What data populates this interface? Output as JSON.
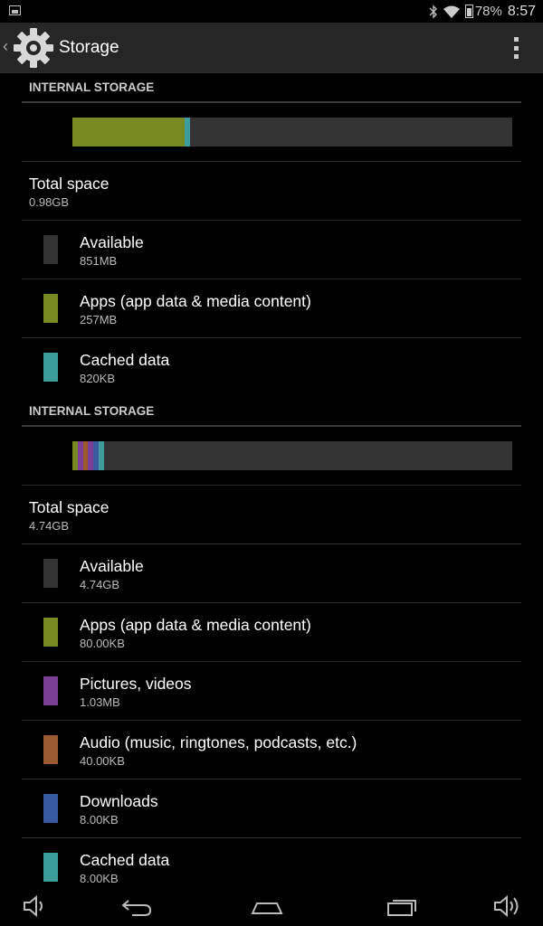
{
  "status_bar": {
    "battery_percent": "78%",
    "time": "8:57",
    "icons": [
      "image-notification-icon",
      "bluetooth-icon",
      "wifi-icon",
      "battery-icon"
    ]
  },
  "action_bar": {
    "title": "Storage",
    "icons": [
      "back-chevron-icon",
      "settings-gear-icon",
      "overflow-menu-icon"
    ]
  },
  "sections": [
    {
      "header": "INTERNAL STORAGE",
      "total_label": "Total space",
      "total_value": "0.98GB",
      "bar_segments": [
        {
          "color": "#7a8a22",
          "fraction": 0.255
        },
        {
          "color": "#3d9c9c",
          "fraction": 0.012
        }
      ],
      "items": [
        {
          "label": "Available",
          "value": "851MB",
          "color": "#333333"
        },
        {
          "label": "Apps (app data & media content)",
          "value": "257MB",
          "color": "#7a8a22"
        },
        {
          "label": "Cached data",
          "value": "820KB",
          "color": "#3d9c9c"
        }
      ]
    },
    {
      "header": "INTERNAL STORAGE",
      "total_label": "Total space",
      "total_value": "4.74GB",
      "bar_segments": [
        {
          "color": "#7a8a22",
          "fraction": 0.012
        },
        {
          "color": "#7b3f96",
          "fraction": 0.012
        },
        {
          "color": "#9a5a30",
          "fraction": 0.012
        },
        {
          "color": "#7b3f96",
          "fraction": 0.012
        },
        {
          "color": "#3a5aa0",
          "fraction": 0.012
        },
        {
          "color": "#3d9c9c",
          "fraction": 0.012
        }
      ],
      "items": [
        {
          "label": "Available",
          "value": "4.74GB",
          "color": "#333333"
        },
        {
          "label": "Apps (app data & media content)",
          "value": "80.00KB",
          "color": "#7a8a22"
        },
        {
          "label": "Pictures, videos",
          "value": "1.03MB",
          "color": "#7b3f96"
        },
        {
          "label": "Audio (music, ringtones, podcasts, etc.)",
          "value": "40.00KB",
          "color": "#9a5a30"
        },
        {
          "label": "Downloads",
          "value": "8.00KB",
          "color": "#3a5aa0"
        },
        {
          "label": "Cached data",
          "value": "8.00KB",
          "color": "#3d9c9c"
        }
      ]
    }
  ],
  "nav_bar": {
    "icons": [
      "volume-down-icon",
      "back-icon",
      "home-icon",
      "recent-apps-icon",
      "volume-up-icon"
    ]
  }
}
